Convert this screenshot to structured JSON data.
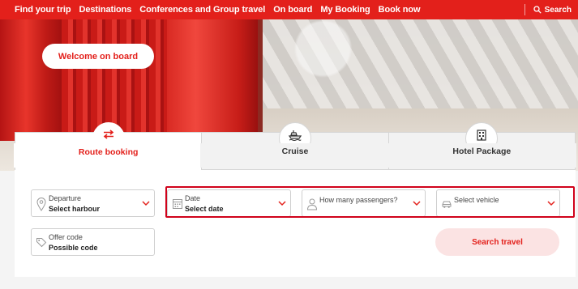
{
  "nav": {
    "items": [
      "Find your trip",
      "Destinations",
      "Conferences and Group travel",
      "On board",
      "My Booking",
      "Book now"
    ],
    "search_label": "Search"
  },
  "hero": {
    "welcome_label": "Welcome on board"
  },
  "tabs": [
    {
      "label": "Route booking",
      "icon": "swap-arrows-icon",
      "active": true
    },
    {
      "label": "Cruise",
      "icon": "ship-icon",
      "active": false
    },
    {
      "label": "Hotel Package",
      "icon": "hotel-icon",
      "active": false
    }
  ],
  "form": {
    "departure": {
      "label": "Departure",
      "value": "Select harbour",
      "icon": "location-pin-icon"
    },
    "date": {
      "label": "Date",
      "value": "Select date",
      "icon": "calendar-icon"
    },
    "passengers": {
      "label": "How many passengers?",
      "icon": "person-icon"
    },
    "vehicle": {
      "label": "Select vehicle",
      "icon": "car-icon"
    },
    "offer_code": {
      "label": "Offer code",
      "value": "Possible code",
      "icon": "tag-icon"
    },
    "search_button": "Search travel"
  },
  "colors": {
    "brand_red": "#e3201b",
    "highlight_red": "#d0021b",
    "search_button_bg": "#fbe3e3"
  }
}
